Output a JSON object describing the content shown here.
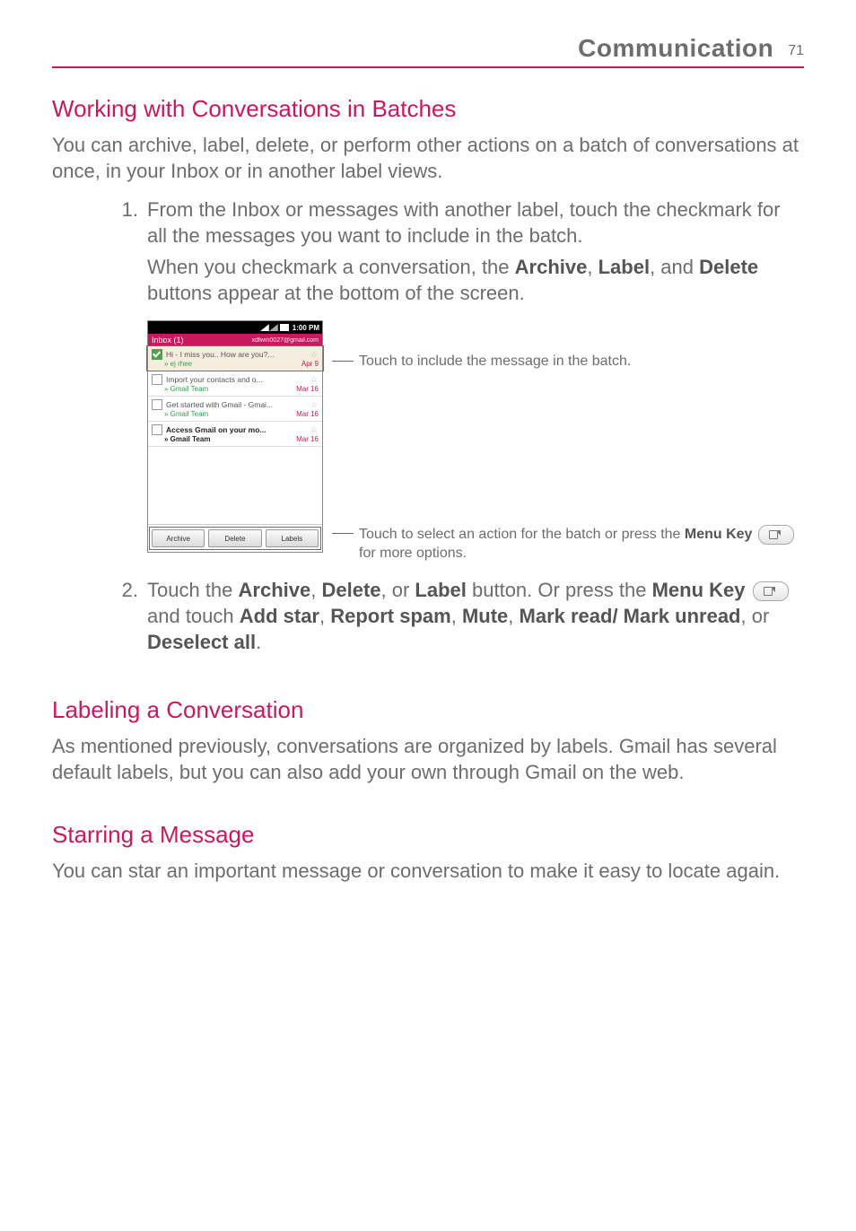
{
  "header": {
    "title": "Communication",
    "page": "71"
  },
  "sections": {
    "batches": {
      "heading": "Working with Conversations in Batches",
      "intro": "You can archive, label, delete, or perform other actions on a batch of conversations at once, in your Inbox or in another label views.",
      "step1_num": "1.",
      "step1_p1": "From the Inbox or messages with another label, touch the checkmark for all the messages you want to include in the batch.",
      "step1_p2a": "When you checkmark a conversation, the ",
      "step1_p2_b1": "Archive",
      "step1_p2_sep1": ", ",
      "step1_p2_b2": "Label",
      "step1_p2_sep2": ", and ",
      "step1_p2_b3": "Delete",
      "step1_p2_tail": " buttons appear at the bottom of the screen.",
      "step2_num": "2.",
      "step2_a": "Touch the ",
      "step2_b1": "Archive",
      "step2_s1": ", ",
      "step2_b2": "Delete",
      "step2_s2": ", or ",
      "step2_b3": "Label",
      "step2_mid": " button. Or press the ",
      "step2_b4": "Menu Key",
      "step2_mid2": " and touch ",
      "step2_b5": "Add star",
      "step2_s3": ", ",
      "step2_b6": "Report spam",
      "step2_s4": ", ",
      "step2_b7": "Mute",
      "step2_s5": ", ",
      "step2_b8": "Mark read/ Mark unread",
      "step2_s6": ", or ",
      "step2_b9": "Deselect all",
      "step2_tail": "."
    },
    "labeling": {
      "heading": "Labeling a Conversation",
      "body": "As mentioned previously, conversations are organized by labels. Gmail has several default labels, but you can also add your own through Gmail on the web."
    },
    "starring": {
      "heading": "Starring a Message",
      "body": "You can star an important message or conversation to make it easy to locate again."
    }
  },
  "screenshot": {
    "statusbar_time": "1:00 PM",
    "inbox_label": "Inbox (1)",
    "account": "xdfwin0027@gmail.com",
    "messages": [
      {
        "subject": "Hi - I miss you.. How are you?...",
        "from": "» ej rhee",
        "date": "Apr 9"
      },
      {
        "subject": "Import your contacts and o...",
        "from": "» Gmail Team",
        "date": "Mar 16"
      },
      {
        "subject": "Get started with Gmail - Gmai...",
        "from": "» Gmail Team",
        "date": "Mar 16"
      },
      {
        "subject": "Access Gmail on your mo...",
        "from": "» Gmail Team",
        "date": "Mar 16"
      }
    ],
    "actions": {
      "archive": "Archive",
      "delete": "Delete",
      "labels": "Labels"
    }
  },
  "callouts": {
    "c1": "Touch to include the message in the batch.",
    "c2a": "Touch to select an action for the batch or press the ",
    "c2b": "Menu Key",
    "c2c": "  for more options."
  }
}
